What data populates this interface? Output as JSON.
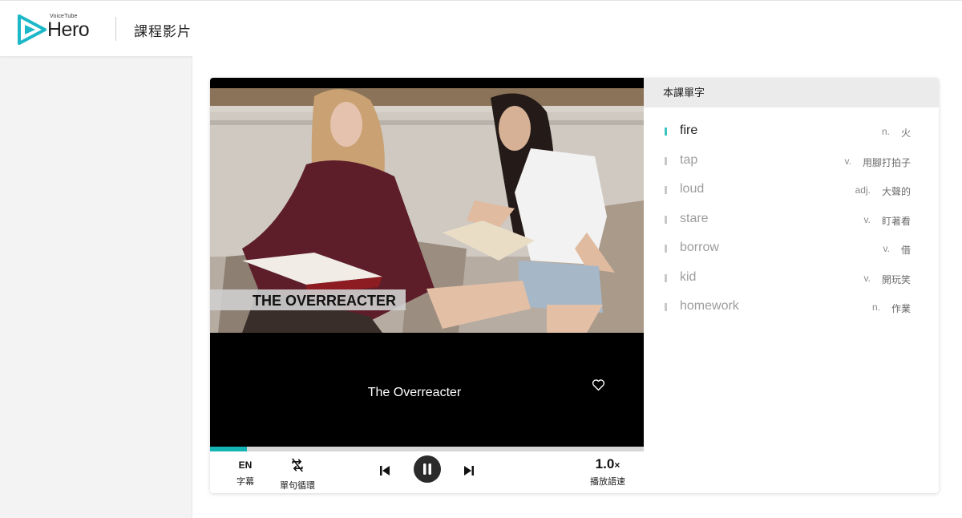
{
  "app": {
    "brand_small": "VoiceTube",
    "brand_name": "Hero",
    "page_title": "課程影片"
  },
  "video": {
    "overlay_title": "THE OVERREACTER",
    "caption": "The Overreacter",
    "progress_fraction": 0.085
  },
  "controls": {
    "subtitle_lang": "EN",
    "subtitle_label": "字幕",
    "loop_label": "單句循環",
    "rate_value": "1.0",
    "rate_unit": "×",
    "rate_label": "播放語速"
  },
  "vocab": {
    "header": "本課單字",
    "words": [
      {
        "word": "fire",
        "pos": "n.",
        "meaning": "火",
        "active": true
      },
      {
        "word": "tap",
        "pos": "v.",
        "meaning": "用腳打拍子",
        "active": false
      },
      {
        "word": "loud",
        "pos": "adj.",
        "meaning": "大聲的",
        "active": false
      },
      {
        "word": "stare",
        "pos": "v.",
        "meaning": "盯著看",
        "active": false
      },
      {
        "word": "borrow",
        "pos": "v.",
        "meaning": "借",
        "active": false
      },
      {
        "word": "kid",
        "pos": "v.",
        "meaning": "開玩笑",
        "active": false
      },
      {
        "word": "homework",
        "pos": "n.",
        "meaning": "作業",
        "active": false
      }
    ]
  },
  "colors": {
    "accent": "#14b4b4",
    "logo": "#1cb8c8"
  },
  "icons": {
    "logo": "play-triangle-logo-icon",
    "heart": "heart-icon",
    "loop": "repeat-off-icon",
    "prev": "skip-previous-icon",
    "pause": "pause-icon",
    "next": "skip-next-icon"
  }
}
